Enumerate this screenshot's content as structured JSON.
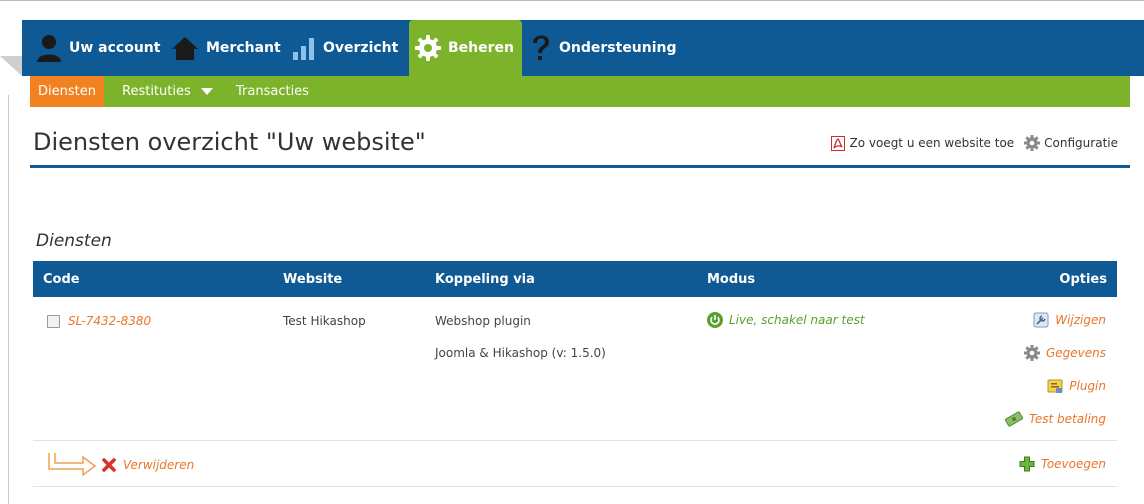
{
  "nav": {
    "items": [
      {
        "label": "Uw account",
        "icon": "user-icon"
      },
      {
        "label": "Merchant",
        "icon": "home-icon"
      },
      {
        "label": "Overzicht",
        "icon": "bar-chart-icon"
      },
      {
        "label": "Beheren",
        "icon": "gear-icon",
        "active": true
      },
      {
        "label": "Ondersteuning",
        "icon": "question-icon"
      }
    ]
  },
  "subnav": {
    "items": [
      {
        "label": "Diensten",
        "active": true
      },
      {
        "label": "Restituties",
        "has_dropdown": true
      },
      {
        "label": "Transacties"
      }
    ]
  },
  "page": {
    "title": "Diensten overzicht \"Uw website\"",
    "help_link": "Zo voegt u een website toe",
    "config_link": "Configuratie",
    "section_title": "Diensten"
  },
  "table": {
    "headers": {
      "code": "Code",
      "website": "Website",
      "koppeling": "Koppeling via",
      "modus": "Modus",
      "opties": "Opties"
    },
    "row": {
      "code": "SL-7432-8380",
      "website": "Test Hikashop",
      "koppeling_1": "Webshop plugin",
      "koppeling_2": "Joomla & Hikashop (v: 1.5.0)",
      "modus": "Live, schakel naar test",
      "options": [
        "Wijzigen",
        "Gegevens",
        "Plugin",
        "Test betaling"
      ]
    },
    "delete_label": "Verwijderen",
    "add_label": "Toevoegen"
  },
  "colors": {
    "primary_blue": "#0f5a94",
    "green": "#7cb32b",
    "orange": "#f28122",
    "link_orange": "#e8772b"
  }
}
